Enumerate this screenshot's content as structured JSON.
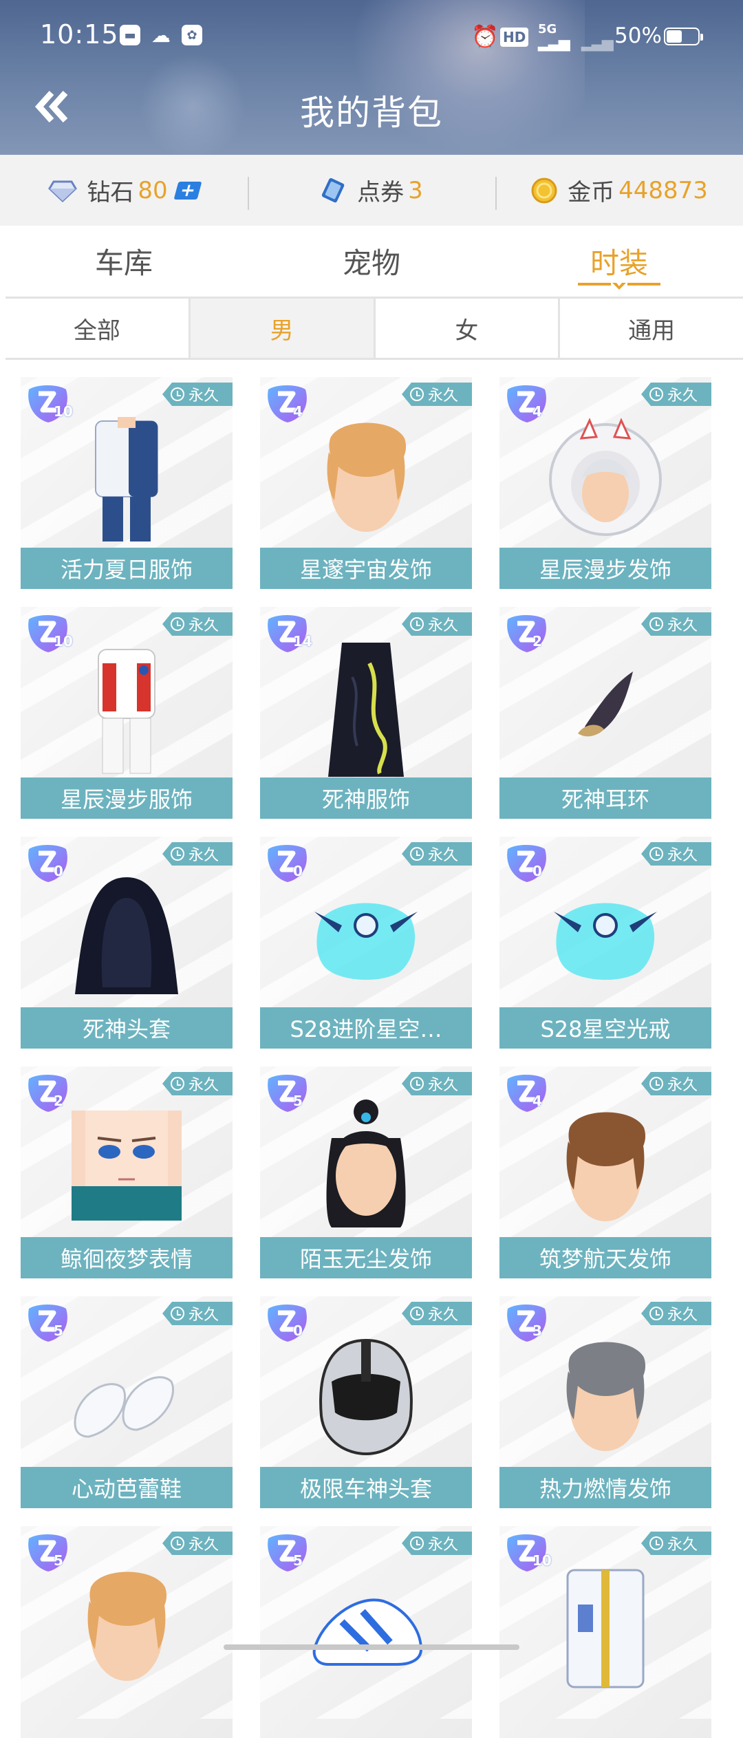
{
  "status_bar": {
    "time": "10:15",
    "network": "5G",
    "hd": "HD",
    "battery": "50%"
  },
  "header": {
    "title": "我的背包",
    "back_icon": "double-chevron-left-icon"
  },
  "currency": {
    "diamond": {
      "label": "钻石",
      "value": "80"
    },
    "coupon": {
      "label": "点券",
      "value": "3"
    },
    "gold": {
      "label": "金币",
      "value": "448873"
    }
  },
  "main_tabs": [
    {
      "label": "车库",
      "active": false
    },
    {
      "label": "宠物",
      "active": false
    },
    {
      "label": "时装",
      "active": true
    }
  ],
  "sub_tabs": [
    {
      "label": "全部",
      "active": false
    },
    {
      "label": "男",
      "active": true
    },
    {
      "label": "女",
      "active": false
    },
    {
      "label": "通用",
      "active": false
    }
  ],
  "items": [
    {
      "name": "活力夏日服饰",
      "level": "10",
      "duration": "永久",
      "art": "outfit-blue"
    },
    {
      "name": "星邃宇宙发饰",
      "level": "4",
      "duration": "永久",
      "art": "hair-blond"
    },
    {
      "name": "星辰漫步发饰",
      "level": "4",
      "duration": "永久",
      "art": "helmet-white"
    },
    {
      "name": "星辰漫步服饰",
      "level": "10",
      "duration": "永久",
      "art": "spacesuit"
    },
    {
      "name": "死神服饰",
      "level": "14",
      "duration": "永久",
      "art": "robe-black"
    },
    {
      "name": "死神耳环",
      "level": "2",
      "duration": "永久",
      "art": "earring"
    },
    {
      "name": "死神头套",
      "level": "0",
      "duration": "永久",
      "art": "hood"
    },
    {
      "name": "S28进阶星空…",
      "level": "0",
      "duration": "永久",
      "art": "ring-cyan"
    },
    {
      "name": "S28星空光戒",
      "level": "0",
      "duration": "永久",
      "art": "ring-cyan"
    },
    {
      "name": "鲸徊夜梦表情",
      "level": "2",
      "duration": "永久",
      "art": "face"
    },
    {
      "name": "陌玉无尘发饰",
      "level": "5",
      "duration": "永久",
      "art": "hair-black"
    },
    {
      "name": "筑梦航天发饰",
      "level": "4",
      "duration": "永久",
      "art": "hair-brown"
    },
    {
      "name": "心动芭蕾鞋",
      "level": "5",
      "duration": "永久",
      "art": "shoes"
    },
    {
      "name": "极限车神头套",
      "level": "0",
      "duration": "永久",
      "art": "helmet-black"
    },
    {
      "name": "热力燃情发饰",
      "level": "3",
      "duration": "永久",
      "art": "hair-grey"
    },
    {
      "name": "",
      "level": "5",
      "duration": "永久",
      "art": "hair-blond"
    },
    {
      "name": "",
      "level": "5",
      "duration": "永久",
      "art": "sneaker"
    },
    {
      "name": "",
      "level": "10",
      "duration": "永久",
      "art": "jacket-white"
    }
  ],
  "colors": {
    "accent": "#e8a22a",
    "teal": "#6cb3bf",
    "header": "#5a6f95"
  }
}
